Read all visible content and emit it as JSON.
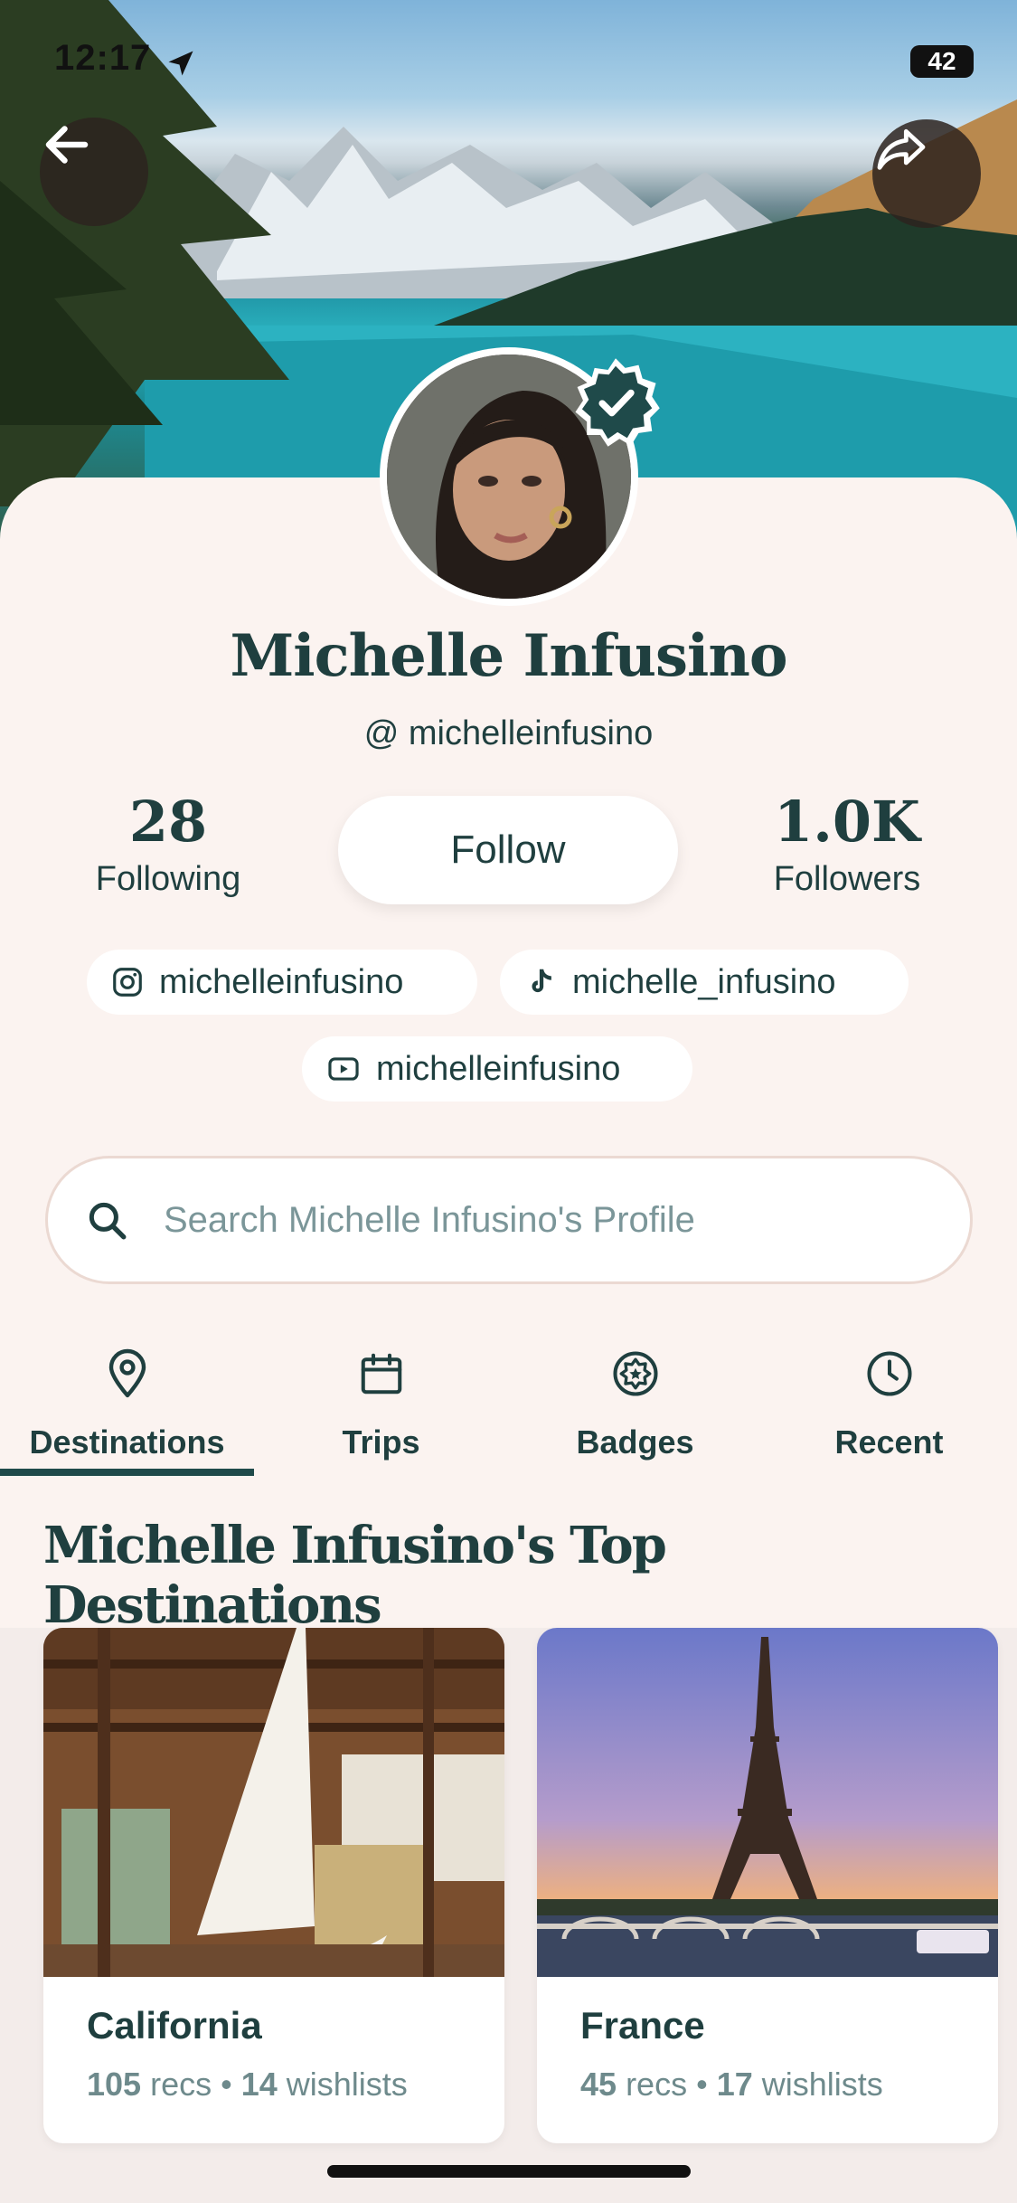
{
  "status_bar": {
    "time": "12:17",
    "battery": "42"
  },
  "header": {
    "back_icon": "arrow-left-icon",
    "share_icon": "share-arrow-icon"
  },
  "profile": {
    "name": "Michelle Infusino",
    "handle": "@ michelleinfusino",
    "following_count": "28",
    "following_label": "Following",
    "followers_count": "1.0K",
    "followers_label": "Followers",
    "follow_button_label": "Follow",
    "verified": true
  },
  "socials": [
    {
      "platform": "instagram",
      "icon": "instagram-icon",
      "handle": "michelleinfusino"
    },
    {
      "platform": "tiktok",
      "icon": "tiktok-icon",
      "handle": "michelle_infusino"
    },
    {
      "platform": "youtube",
      "icon": "youtube-icon",
      "handle": "michelleinfusino"
    }
  ],
  "search": {
    "placeholder": "Search Michelle Infusino's Profile"
  },
  "tabs": [
    {
      "label": "Destinations",
      "icon": "map-pin-icon",
      "active": true
    },
    {
      "label": "Trips",
      "icon": "calendar-icon",
      "active": false
    },
    {
      "label": "Badges",
      "icon": "badge-icon",
      "active": false
    },
    {
      "label": "Recent",
      "icon": "clock-icon",
      "active": false
    }
  ],
  "section": {
    "title": "Michelle Infusino's Top Destinations"
  },
  "destinations": [
    {
      "name": "California",
      "recs": "105",
      "recs_label": "recs",
      "wishlists": "14",
      "wishlists_label": "wishlists"
    },
    {
      "name": "France",
      "recs": "45",
      "recs_label": "recs",
      "wishlists": "17",
      "wishlists_label": "wishlists"
    }
  ],
  "colors": {
    "background": "#FBF3F0",
    "primary_text": "#1F3F3F",
    "muted_text": "#6E8A8C",
    "tab_indicator": "#1F4A4A"
  }
}
